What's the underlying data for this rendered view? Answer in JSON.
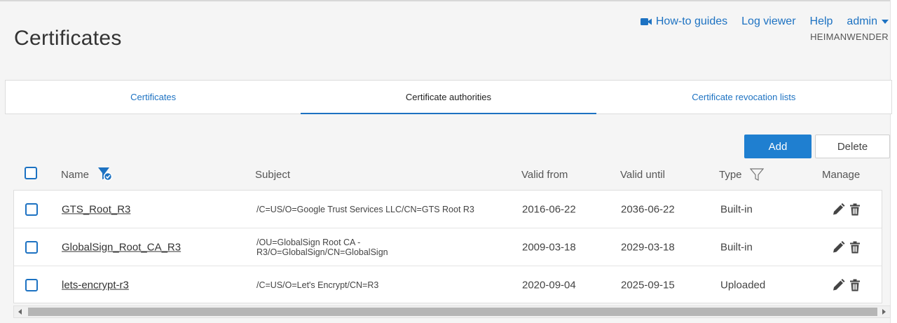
{
  "page": {
    "title": "Certificates"
  },
  "topnav": {
    "howto_label": "How-to guides",
    "log_viewer_label": "Log viewer",
    "help_label": "Help",
    "user_label": "admin",
    "host_label": "HEIMANWENDER"
  },
  "tabs": [
    {
      "label": "Certificates",
      "active": false
    },
    {
      "label": "Certificate authorities",
      "active": true
    },
    {
      "label": "Certificate revocation lists",
      "active": false
    }
  ],
  "toolbar": {
    "add_label": "Add",
    "delete_label": "Delete"
  },
  "table": {
    "columns": {
      "name": "Name",
      "subject": "Subject",
      "valid_from": "Valid from",
      "valid_until": "Valid until",
      "type": "Type",
      "manage": "Manage"
    },
    "rows": [
      {
        "name": "GTS_Root_R3",
        "subject": "/C=US/O=Google Trust Services LLC/CN=GTS Root R3",
        "valid_from": "2016-06-22",
        "valid_until": "2036-06-22",
        "type": "Built-in"
      },
      {
        "name": "GlobalSign_Root_CA_R3",
        "subject": "/OU=GlobalSign Root CA - R3/O=GlobalSign/CN=GlobalSign",
        "valid_from": "2009-03-18",
        "valid_until": "2029-03-18",
        "type": "Built-in"
      },
      {
        "name": "lets-encrypt-r3",
        "subject": "/C=US/O=Let's Encrypt/CN=R3",
        "valid_from": "2020-09-04",
        "valid_until": "2025-09-15",
        "type": "Uploaded"
      }
    ]
  },
  "colors": {
    "accent": "#1d72c2",
    "add_button": "#1f7fd0",
    "background": "#f5f5f5"
  },
  "icons": {
    "howto": "video-camera-icon",
    "name_filter": "filter-active-icon",
    "type_filter": "filter-icon",
    "edit": "pencil-icon",
    "delete": "trash-icon"
  }
}
